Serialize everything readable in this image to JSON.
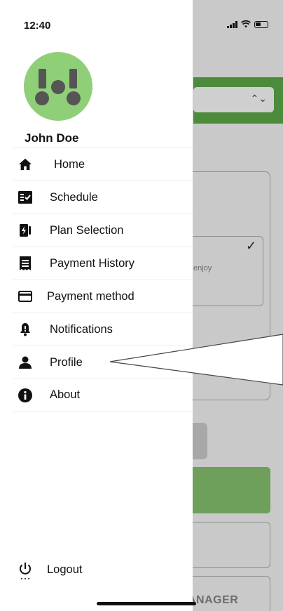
{
  "status_bar": {
    "time": "12:40"
  },
  "drawer": {
    "user_name": "John Doe",
    "menu": [
      {
        "label": "Home",
        "icon": "home-icon"
      },
      {
        "label": "Schedule",
        "icon": "schedule-icon"
      },
      {
        "label": "Plan Selection",
        "icon": "plan-selection-icon"
      },
      {
        "label": "Payment History",
        "icon": "payment-history-icon"
      },
      {
        "label": "Payment method",
        "icon": "credit-card-icon"
      },
      {
        "label": "Notifications",
        "icon": "bell-icon"
      },
      {
        "label": "Profile",
        "icon": "person-icon"
      },
      {
        "label": "About",
        "icon": "info-icon"
      }
    ],
    "logout_label": "Logout"
  },
  "background": {
    "card_text": "enjoy",
    "button_text": "ANAGER"
  },
  "colors": {
    "avatar_bg": "#8fcf78",
    "accent_green": "#4b8b3b",
    "overlay_gray": "#c9c9c9"
  }
}
